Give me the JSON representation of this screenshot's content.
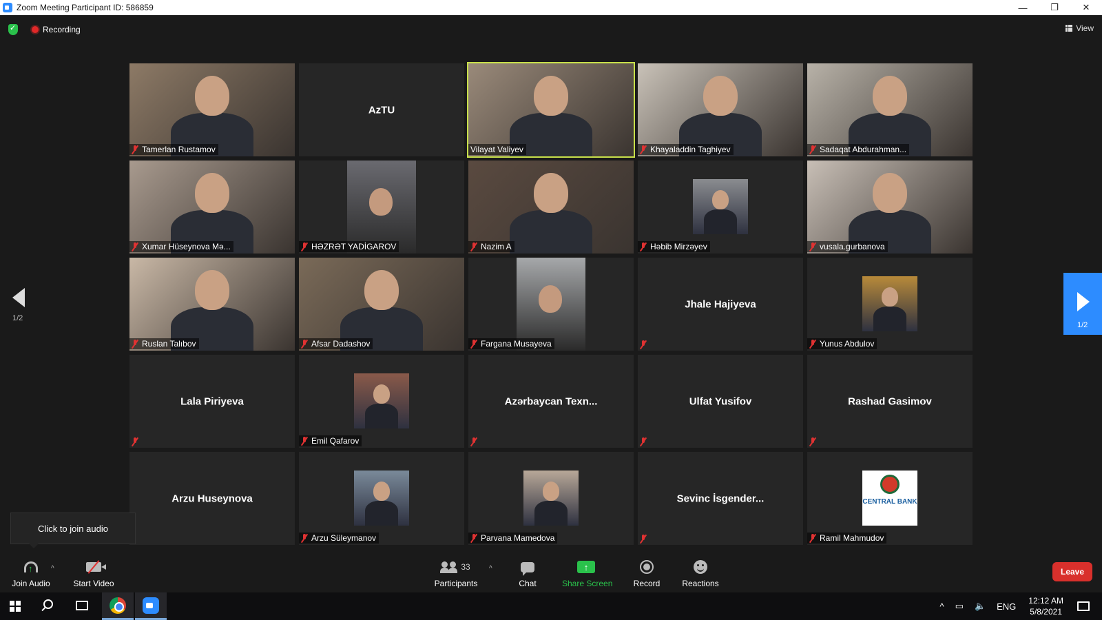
{
  "window": {
    "title": "Zoom Meeting Participant ID: 586859",
    "minimize": "—",
    "maximize": "❐",
    "close": "✕"
  },
  "topbar": {
    "recording": "Recording",
    "view": "View"
  },
  "tiles": [
    {
      "name": "Tamerlan Rustamov",
      "muted": true,
      "video": "full",
      "bg": "#8d7a66",
      "big": ""
    },
    {
      "name": "",
      "muted": false,
      "video": "none",
      "bg": "#262626",
      "big": "AzTU"
    },
    {
      "name": "Vilayat Valiyev",
      "muted": false,
      "video": "full",
      "bg": "#9a8a7a",
      "big": "",
      "active": true
    },
    {
      "name": "Khayaladdin Taghiyev",
      "muted": true,
      "video": "full",
      "bg": "#c9c2b8",
      "big": ""
    },
    {
      "name": "Sadaqat Abdurahman...",
      "muted": true,
      "video": "full",
      "bg": "#b8b2a8",
      "big": ""
    },
    {
      "name": "Xumar Hüseynova  Mə...",
      "muted": true,
      "video": "full",
      "bg": "#a89a8e",
      "big": ""
    },
    {
      "name": "HƏZRƏT YADİGAROV",
      "muted": true,
      "video": "portrait",
      "bg": "#6a6a70",
      "big": ""
    },
    {
      "name": "Nazim A",
      "muted": true,
      "video": "full",
      "bg": "#5a4a40",
      "big": ""
    },
    {
      "name": "Həbib Mirzəyev",
      "muted": true,
      "video": "thumb",
      "bg": "#8a8c90",
      "big": ""
    },
    {
      "name": "vusala.gurbanova",
      "muted": true,
      "video": "full",
      "bg": "#c8bfb6",
      "big": ""
    },
    {
      "name": "Ruslan Talıbov",
      "muted": true,
      "video": "full",
      "bg": "#c9b8a6",
      "big": ""
    },
    {
      "name": "Afsar Dadashov",
      "muted": true,
      "video": "full",
      "bg": "#7a6a58",
      "big": ""
    },
    {
      "name": "Fargana Musayeva",
      "muted": true,
      "video": "portrait",
      "bg": "#a6a8aa",
      "big": ""
    },
    {
      "name": "",
      "muted": true,
      "video": "none",
      "bg": "#262626",
      "big": "Jhale Hajiyeva"
    },
    {
      "name": "Yunus Abdulov",
      "muted": true,
      "video": "thumb",
      "bg": "#b88a3a",
      "big": ""
    },
    {
      "name": "",
      "muted": true,
      "video": "none",
      "bg": "#262626",
      "big": "Lala Piriyeva"
    },
    {
      "name": "Emil Qafarov",
      "muted": true,
      "video": "thumb",
      "bg": "#8a5a4a",
      "big": ""
    },
    {
      "name": "",
      "muted": true,
      "video": "none",
      "bg": "#262626",
      "big": "Azərbaycan Texn..."
    },
    {
      "name": "",
      "muted": true,
      "video": "none",
      "bg": "#262626",
      "big": "Ulfat Yusifov"
    },
    {
      "name": "",
      "muted": true,
      "video": "none",
      "bg": "#262626",
      "big": "Rashad Gasimov"
    },
    {
      "name": "",
      "muted": false,
      "video": "none",
      "bg": "#262626",
      "big": "Arzu Huseynova"
    },
    {
      "name": "Arzu Süleymanov",
      "muted": true,
      "video": "thumb",
      "bg": "#7a8a9a",
      "big": ""
    },
    {
      "name": "Parvana Mamedova",
      "muted": true,
      "video": "thumb",
      "bg": "#b8a898",
      "big": ""
    },
    {
      "name": "",
      "muted": true,
      "video": "none",
      "bg": "#262626",
      "big": "Sevinc  İsgender..."
    },
    {
      "name": "Ramil Mahmudov",
      "muted": true,
      "video": "logo",
      "bg": "#ffffff",
      "big": "",
      "logo_text": "CENTRAL BANK"
    }
  ],
  "nav": {
    "left_page": "1/2",
    "right_page": "1/2"
  },
  "tooltip": "Click to join audio",
  "toolbar": {
    "join_audio": "Join Audio",
    "start_video": "Start Video",
    "participants": "Participants",
    "participants_count": "33",
    "chat": "Chat",
    "share_screen": "Share Screen",
    "record": "Record",
    "reactions": "Reactions",
    "leave": "Leave"
  },
  "taskbar": {
    "lang": "ENG",
    "time": "12:12 AM",
    "date": "5/8/2021"
  }
}
